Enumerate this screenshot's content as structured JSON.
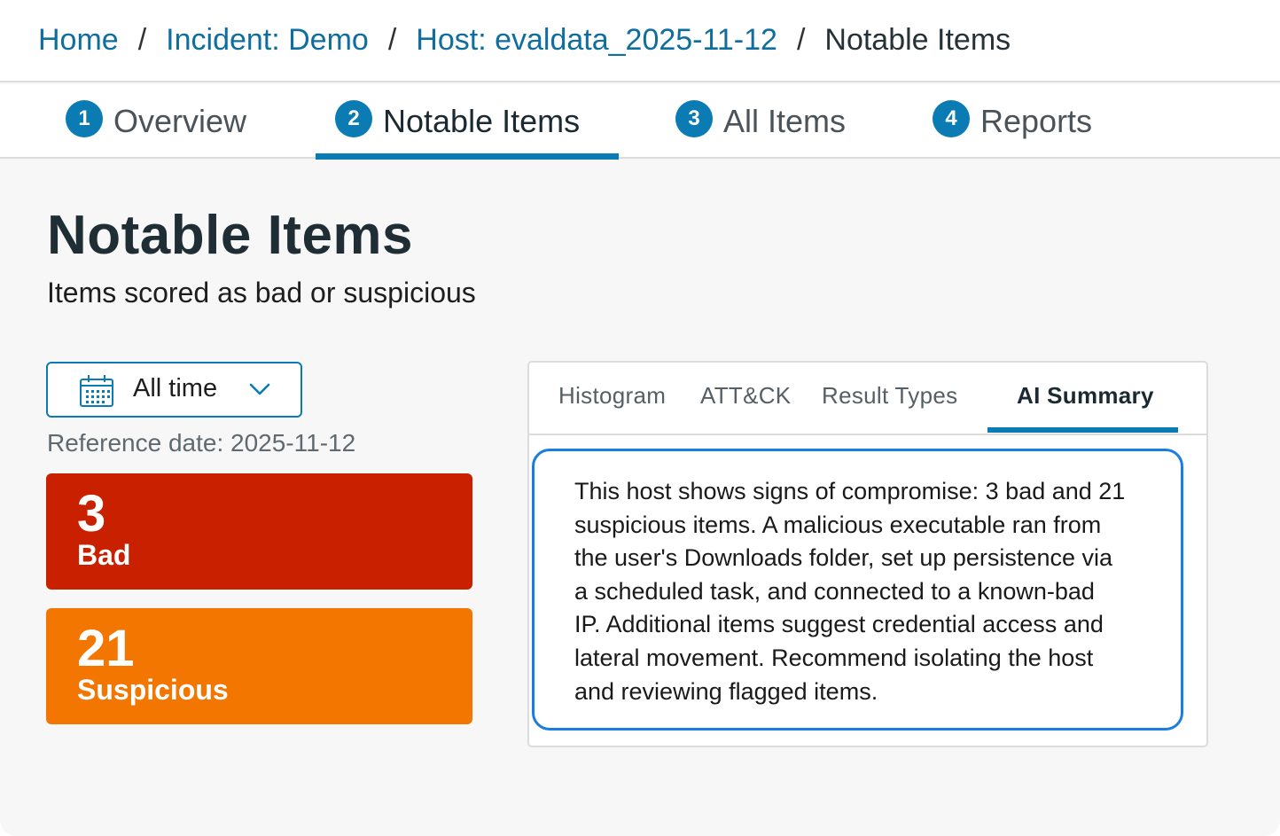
{
  "breadcrumb": {
    "home": "Home",
    "incident": "Incident: Demo",
    "host": "Host: evaldata_2025-11-12",
    "current": "Notable Items",
    "separator": "/"
  },
  "steps": [
    {
      "num": "1",
      "label": "Overview"
    },
    {
      "num": "2",
      "label": "Notable Items",
      "active": true
    },
    {
      "num": "3",
      "label": "All Items"
    },
    {
      "num": "4",
      "label": "Reports"
    }
  ],
  "page": {
    "title": "Notable Items",
    "subtitle": "Items scored as bad or suspicious"
  },
  "filter": {
    "time_range": "All time",
    "reference_date": "Reference date: 2025-11-12"
  },
  "scores": {
    "bad": {
      "count": "3",
      "label": "Bad",
      "color": "#c92100"
    },
    "suspicious": {
      "count": "21",
      "label": "Suspicious",
      "color": "#f27600"
    }
  },
  "panel": {
    "tabs": [
      "Histogram",
      "ATT&CK",
      "Result Types",
      "AI Summary"
    ],
    "active_tab": "AI Summary",
    "summary_lines": [
      "This host shows signs of compromise: 3 bad and 21",
      "suspicious items. A malicious executable ran from",
      "the user's Downloads folder, set up persistence via",
      "a scheduled task, and connected to a known-bad",
      "IP. Additional items suggest credential access and",
      "lateral movement. Recommend isolating the host",
      "and reviewing flagged items."
    ]
  },
  "colors": {
    "accent": "#0a7bb3",
    "link": "#0f6e9e",
    "focus": "#1a7de0"
  },
  "icons": {
    "time_filter": "calendar-icon",
    "dropdown": "chevron-down-icon"
  }
}
